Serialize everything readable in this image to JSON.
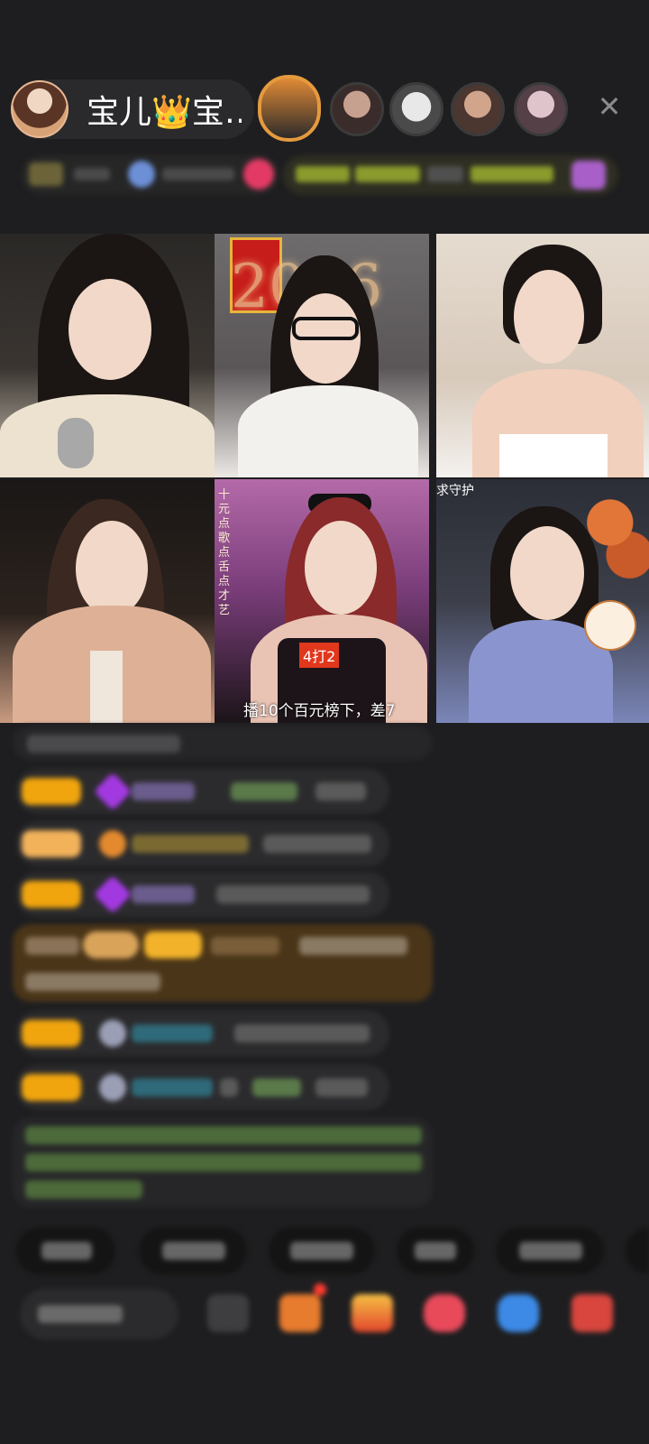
{
  "host": {
    "name": "宝儿👑宝…",
    "avatar_icon": "host-avatar"
  },
  "top": {
    "viewers": [
      {
        "color": "#d37a2e"
      },
      {
        "color": "#8a6b5a"
      },
      {
        "color": "#c9c9c9"
      },
      {
        "color": "#9b7562"
      },
      {
        "color": "#a78d95"
      }
    ],
    "close_icon": "✕"
  },
  "grid": {
    "t2_number": "2026",
    "t5_vertical_text": "十元点歌点舌点才艺",
    "t5_tag": "4打2",
    "t5_caption": "播10个百元榜下，差7",
    "t6_overlay": "求守护"
  },
  "chat": {
    "rows": [
      {
        "kind": "system"
      },
      {
        "kind": "msg",
        "badge": "gold",
        "gem": "#a239e0"
      },
      {
        "kind": "msg",
        "badge": "orange",
        "gem": "#e38a2e"
      },
      {
        "kind": "msg",
        "badge": "gold",
        "gem": "#a239e0"
      },
      {
        "kind": "gift"
      },
      {
        "kind": "msg",
        "badge": "gold",
        "gem": "#9b9fb6"
      },
      {
        "kind": "msg",
        "badge": "gold",
        "gem": "#9b9fb6"
      },
      {
        "kind": "notice"
      }
    ]
  },
  "colors": {
    "accent_gold": "#f0a50e",
    "notice_green": "#6fae52",
    "cyan_name": "#38b8c8"
  }
}
